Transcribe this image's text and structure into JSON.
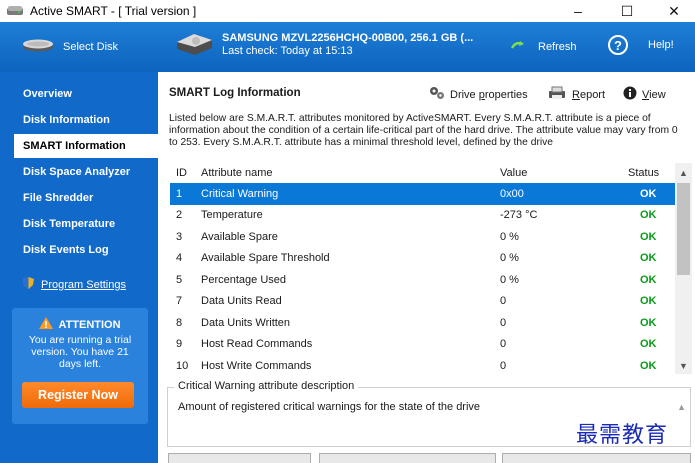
{
  "window": {
    "title": "Active SMART - [ Trial version ]",
    "controls": {
      "minimize": "–",
      "maximize": "☐",
      "close": "✕"
    }
  },
  "header": {
    "select_disk_label": "Select Disk",
    "disk_name": "SAMSUNG MZVL2256HCHQ-00B00, 256.1 GB (...",
    "last_check": "Last check: Today at 15:13",
    "refresh_label": "Refresh",
    "help_label": "Help!",
    "help_symbol": "?"
  },
  "sidebar": {
    "items": [
      {
        "label": "Overview",
        "active": false
      },
      {
        "label": "Disk Information",
        "active": false
      },
      {
        "label": "SMART Information",
        "active": true
      },
      {
        "label": "Disk Space Analyzer",
        "active": false
      },
      {
        "label": "File Shredder",
        "active": false
      },
      {
        "label": "Disk Temperature",
        "active": false
      },
      {
        "label": "Disk Events Log",
        "active": false
      }
    ],
    "program_settings": "Program Settings",
    "attention": {
      "title": "ATTENTION",
      "message": "You are running a trial version. You have 21 days left.",
      "register_button": "Register Now"
    }
  },
  "panel": {
    "title": "SMART Log Information",
    "toolbar": {
      "drive_pre": "Drive ",
      "drive_ul": "p",
      "drive_post": "roperties",
      "report_pre": "",
      "report_ul": "R",
      "report_post": "eport",
      "view_pre": "",
      "view_ul": "V",
      "view_post": "iew"
    },
    "intro": "Listed below are S.M.A.R.T. attributes monitored by ActiveSMART. Every S.M.A.R.T. attribute is a piece of information about the condition of a certain life-critical part of the hard drive. The attribute value may vary from 0 to 253. Every S.M.A.R.T. attribute has a minimal threshold level, defined by the drive"
  },
  "table": {
    "headers": {
      "id": "ID",
      "name": "Attribute name",
      "value": "Value",
      "status": "Status"
    },
    "rows": [
      {
        "id": "1",
        "name": "Critical Warning",
        "value": "0x00",
        "status": "OK"
      },
      {
        "id": "2",
        "name": "Temperature",
        "value": "-273 °C",
        "status": "OK"
      },
      {
        "id": "3",
        "name": "Available Spare",
        "value": "0 %",
        "status": "OK"
      },
      {
        "id": "4",
        "name": "Available Spare Threshold",
        "value": "0 %",
        "status": "OK"
      },
      {
        "id": "5",
        "name": "Percentage Used",
        "value": "0 %",
        "status": "OK"
      },
      {
        "id": "7",
        "name": "Data Units Read",
        "value": "0",
        "status": "OK"
      },
      {
        "id": "8",
        "name": "Data Units Written",
        "value": "0",
        "status": "OK"
      },
      {
        "id": "9",
        "name": "Host Read Commands",
        "value": "0",
        "status": "OK"
      },
      {
        "id": "10",
        "name": "Host Write Commands",
        "value": "0",
        "status": "OK"
      }
    ],
    "selected_index": 0
  },
  "description": {
    "legend": "Critical Warning attribute description",
    "text": "Amount of registered critical warnings for the state of the drive"
  },
  "watermark": "最需教育",
  "colors": {
    "header_blue": "#1e7fd6",
    "sidebar_blue": "#1169c9",
    "selection_blue": "#0a78d7",
    "ok_green": "#0a9a1a",
    "register_orange": "#f06a08"
  }
}
